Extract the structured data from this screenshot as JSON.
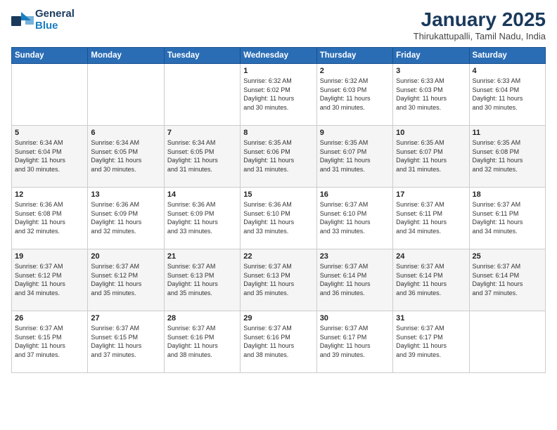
{
  "header": {
    "logo_general": "General",
    "logo_blue": "Blue",
    "title": "January 2025",
    "subtitle": "Thirukattupalli, Tamil Nadu, India"
  },
  "weekdays": [
    "Sunday",
    "Monday",
    "Tuesday",
    "Wednesday",
    "Thursday",
    "Friday",
    "Saturday"
  ],
  "weeks": [
    [
      {
        "day": "",
        "info": ""
      },
      {
        "day": "",
        "info": ""
      },
      {
        "day": "",
        "info": ""
      },
      {
        "day": "1",
        "info": "Sunrise: 6:32 AM\nSunset: 6:02 PM\nDaylight: 11 hours\nand 30 minutes."
      },
      {
        "day": "2",
        "info": "Sunrise: 6:32 AM\nSunset: 6:03 PM\nDaylight: 11 hours\nand 30 minutes."
      },
      {
        "day": "3",
        "info": "Sunrise: 6:33 AM\nSunset: 6:03 PM\nDaylight: 11 hours\nand 30 minutes."
      },
      {
        "day": "4",
        "info": "Sunrise: 6:33 AM\nSunset: 6:04 PM\nDaylight: 11 hours\nand 30 minutes."
      }
    ],
    [
      {
        "day": "5",
        "info": "Sunrise: 6:34 AM\nSunset: 6:04 PM\nDaylight: 11 hours\nand 30 minutes."
      },
      {
        "day": "6",
        "info": "Sunrise: 6:34 AM\nSunset: 6:05 PM\nDaylight: 11 hours\nand 30 minutes."
      },
      {
        "day": "7",
        "info": "Sunrise: 6:34 AM\nSunset: 6:05 PM\nDaylight: 11 hours\nand 31 minutes."
      },
      {
        "day": "8",
        "info": "Sunrise: 6:35 AM\nSunset: 6:06 PM\nDaylight: 11 hours\nand 31 minutes."
      },
      {
        "day": "9",
        "info": "Sunrise: 6:35 AM\nSunset: 6:07 PM\nDaylight: 11 hours\nand 31 minutes."
      },
      {
        "day": "10",
        "info": "Sunrise: 6:35 AM\nSunset: 6:07 PM\nDaylight: 11 hours\nand 31 minutes."
      },
      {
        "day": "11",
        "info": "Sunrise: 6:35 AM\nSunset: 6:08 PM\nDaylight: 11 hours\nand 32 minutes."
      }
    ],
    [
      {
        "day": "12",
        "info": "Sunrise: 6:36 AM\nSunset: 6:08 PM\nDaylight: 11 hours\nand 32 minutes."
      },
      {
        "day": "13",
        "info": "Sunrise: 6:36 AM\nSunset: 6:09 PM\nDaylight: 11 hours\nand 32 minutes."
      },
      {
        "day": "14",
        "info": "Sunrise: 6:36 AM\nSunset: 6:09 PM\nDaylight: 11 hours\nand 33 minutes."
      },
      {
        "day": "15",
        "info": "Sunrise: 6:36 AM\nSunset: 6:10 PM\nDaylight: 11 hours\nand 33 minutes."
      },
      {
        "day": "16",
        "info": "Sunrise: 6:37 AM\nSunset: 6:10 PM\nDaylight: 11 hours\nand 33 minutes."
      },
      {
        "day": "17",
        "info": "Sunrise: 6:37 AM\nSunset: 6:11 PM\nDaylight: 11 hours\nand 34 minutes."
      },
      {
        "day": "18",
        "info": "Sunrise: 6:37 AM\nSunset: 6:11 PM\nDaylight: 11 hours\nand 34 minutes."
      }
    ],
    [
      {
        "day": "19",
        "info": "Sunrise: 6:37 AM\nSunset: 6:12 PM\nDaylight: 11 hours\nand 34 minutes."
      },
      {
        "day": "20",
        "info": "Sunrise: 6:37 AM\nSunset: 6:12 PM\nDaylight: 11 hours\nand 35 minutes."
      },
      {
        "day": "21",
        "info": "Sunrise: 6:37 AM\nSunset: 6:13 PM\nDaylight: 11 hours\nand 35 minutes."
      },
      {
        "day": "22",
        "info": "Sunrise: 6:37 AM\nSunset: 6:13 PM\nDaylight: 11 hours\nand 35 minutes."
      },
      {
        "day": "23",
        "info": "Sunrise: 6:37 AM\nSunset: 6:14 PM\nDaylight: 11 hours\nand 36 minutes."
      },
      {
        "day": "24",
        "info": "Sunrise: 6:37 AM\nSunset: 6:14 PM\nDaylight: 11 hours\nand 36 minutes."
      },
      {
        "day": "25",
        "info": "Sunrise: 6:37 AM\nSunset: 6:14 PM\nDaylight: 11 hours\nand 37 minutes."
      }
    ],
    [
      {
        "day": "26",
        "info": "Sunrise: 6:37 AM\nSunset: 6:15 PM\nDaylight: 11 hours\nand 37 minutes."
      },
      {
        "day": "27",
        "info": "Sunrise: 6:37 AM\nSunset: 6:15 PM\nDaylight: 11 hours\nand 37 minutes."
      },
      {
        "day": "28",
        "info": "Sunrise: 6:37 AM\nSunset: 6:16 PM\nDaylight: 11 hours\nand 38 minutes."
      },
      {
        "day": "29",
        "info": "Sunrise: 6:37 AM\nSunset: 6:16 PM\nDaylight: 11 hours\nand 38 minutes."
      },
      {
        "day": "30",
        "info": "Sunrise: 6:37 AM\nSunset: 6:17 PM\nDaylight: 11 hours\nand 39 minutes."
      },
      {
        "day": "31",
        "info": "Sunrise: 6:37 AM\nSunset: 6:17 PM\nDaylight: 11 hours\nand 39 minutes."
      },
      {
        "day": "",
        "info": ""
      }
    ]
  ]
}
